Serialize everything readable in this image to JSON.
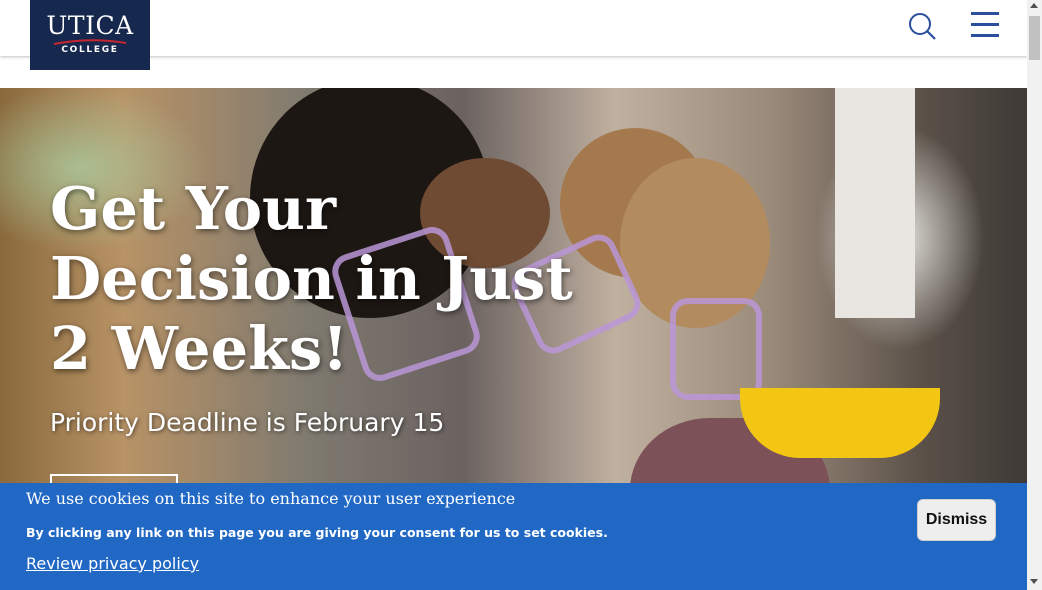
{
  "brand": {
    "name": "UTICA",
    "subtitle": "COLLEGE",
    "colors": {
      "navy": "#16284d",
      "red": "#c8262e",
      "accent_blue": "#2b4e9c"
    }
  },
  "header": {
    "search_icon": "search-icon",
    "menu_icon": "hamburger-menu-icon"
  },
  "hero": {
    "title_lines": [
      "Get Your",
      "Decision in Just",
      "2 Weeks!"
    ],
    "subtitle": "Priority Deadline is February 15"
  },
  "cookie_banner": {
    "message": "We use cookies on this site to enhance your user experience",
    "consent": "By clicking any link on this page you are giving your consent for us to set cookies.",
    "privacy_link": "Review privacy policy",
    "dismiss_label": "Dismiss",
    "background": "#2168c5"
  }
}
